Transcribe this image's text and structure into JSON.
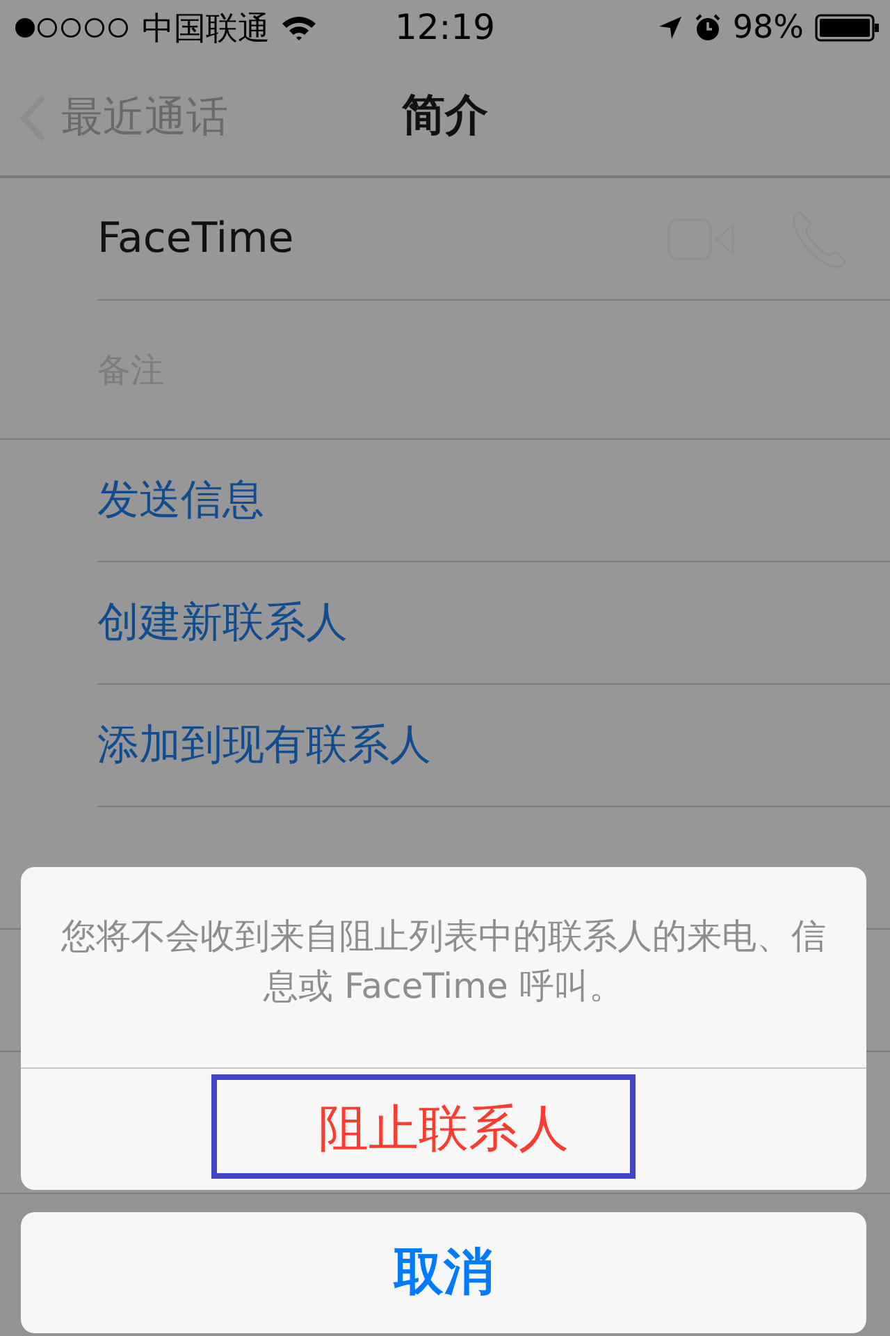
{
  "status_bar": {
    "carrier": "中国联通",
    "time": "12:19",
    "battery": "98%"
  },
  "nav": {
    "back": "最近通话",
    "title": "简介"
  },
  "rows": [
    {
      "kind": "facetime",
      "label": "FaceTime"
    },
    {
      "kind": "note",
      "label": "备注"
    },
    {
      "kind": "action",
      "label": "发送信息"
    },
    {
      "kind": "action",
      "label": "创建新联系人"
    },
    {
      "kind": "action",
      "label": "添加到现有联系人"
    }
  ],
  "action_sheet": {
    "message": "您将不会收到来自阻止列表中的联系人的来电、信息或 FaceTime 呼叫。",
    "buttons": [
      {
        "label": "阻止联系人",
        "kind": "destructive",
        "highlighted": true
      }
    ],
    "cancel": "取消"
  }
}
